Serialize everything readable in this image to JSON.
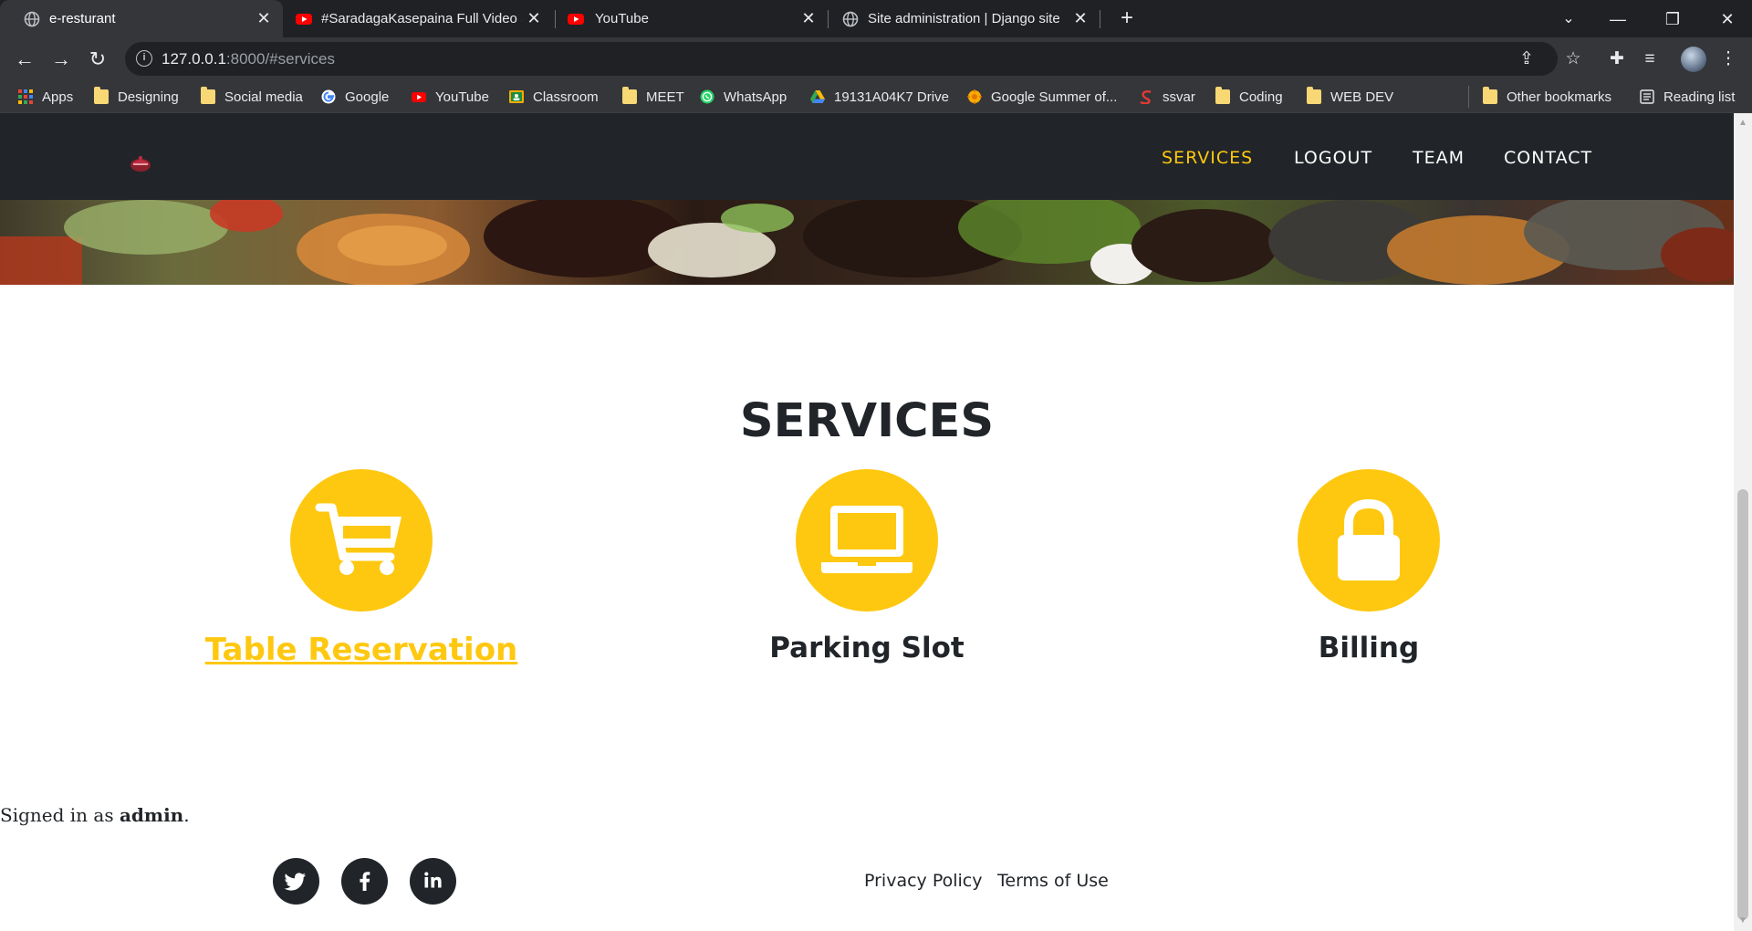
{
  "browser": {
    "tabs": [
      {
        "title": "e-resturant",
        "active": true
      },
      {
        "title": "#SaradagaKasepaina Full Video S",
        "active": false
      },
      {
        "title": "YouTube",
        "active": false
      },
      {
        "title": "Site administration | Django site a",
        "active": false
      }
    ],
    "url_host": "127.0.0.1",
    "url_rest": ":8000/#services",
    "bookmarks": [
      {
        "label": "Apps",
        "icon": "apps-grid-icon"
      },
      {
        "label": "Designing",
        "icon": "folder-icon"
      },
      {
        "label": "Social media",
        "icon": "folder-icon"
      },
      {
        "label": "Google",
        "icon": "google-icon"
      },
      {
        "label": "YouTube",
        "icon": "youtube-icon"
      },
      {
        "label": "Classroom",
        "icon": "classroom-icon"
      },
      {
        "label": "MEET",
        "icon": "folder-icon"
      },
      {
        "label": "WhatsApp",
        "icon": "whatsapp-icon"
      },
      {
        "label": "19131A04K7 Drive",
        "icon": "drive-icon"
      },
      {
        "label": "Google Summer of...",
        "icon": "gsoc-icon"
      },
      {
        "label": "ssvar",
        "icon": "ssvar-icon"
      },
      {
        "label": "Coding",
        "icon": "folder-icon"
      },
      {
        "label": "WEB DEV",
        "icon": "folder-icon"
      }
    ],
    "other_bookmarks": "Other bookmarks",
    "reading_list": "Reading list"
  },
  "nav": {
    "links": [
      "SERVICES",
      "LOGOUT",
      "TEAM",
      "CONTACT"
    ],
    "active": "SERVICES"
  },
  "services": {
    "heading": "SERVICES",
    "items": [
      {
        "title": "Table Reservation",
        "icon": "shopping-cart-icon",
        "link": true
      },
      {
        "title": "Parking Slot",
        "icon": "laptop-icon",
        "link": false
      },
      {
        "title": "Billing",
        "icon": "lock-icon",
        "link": false
      }
    ]
  },
  "user": {
    "prefix": "Signed in as ",
    "name": "admin",
    "suffix": "."
  },
  "footer": {
    "social": [
      "twitter-icon",
      "facebook-icon",
      "linkedin-icon"
    ],
    "links": [
      "Privacy Policy",
      "Terms of Use"
    ]
  },
  "colors": {
    "accent": "#fec810",
    "dark": "#212529"
  }
}
